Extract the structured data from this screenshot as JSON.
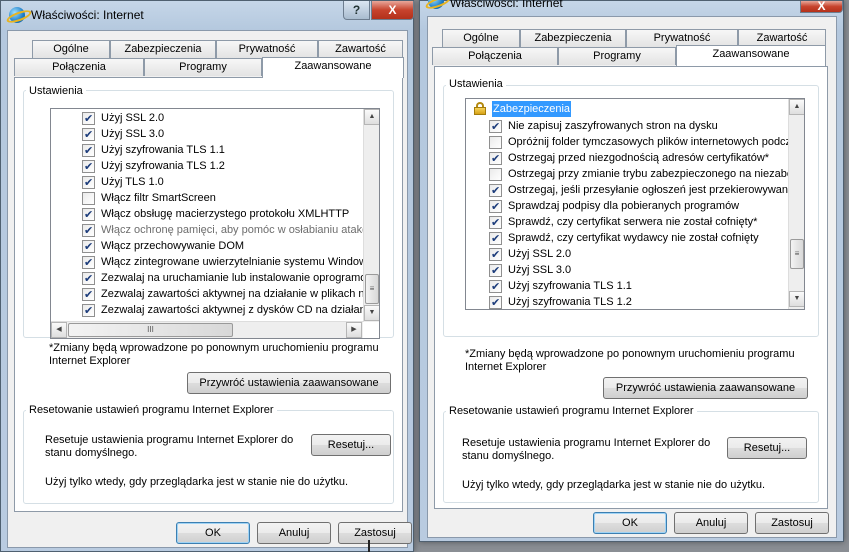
{
  "left": {
    "title": "Właściwości: Internet",
    "tabs_row1": [
      "Ogólne",
      "Zabezpieczenia",
      "Prywatność",
      "Zawartość"
    ],
    "tabs_row2": [
      "Połączenia",
      "Programy",
      "Zaawansowane"
    ],
    "settings_label": "Ustawienia",
    "items": [
      {
        "label": "Użyj SSL 2.0",
        "checked": true
      },
      {
        "label": "Użyj SSL 3.0",
        "checked": true
      },
      {
        "label": "Użyj szyfrowania TLS 1.1",
        "checked": true
      },
      {
        "label": "Użyj szyfrowania TLS 1.2",
        "checked": true
      },
      {
        "label": "Użyj TLS 1.0",
        "checked": true
      },
      {
        "label": "Włącz filtr SmartScreen",
        "checked": false
      },
      {
        "label": "Włącz obsługę macierzystego protokołu XMLHTTP",
        "checked": true
      },
      {
        "label": "Włącz ochronę pamięci, aby pomóc w osłabianiu ataków w",
        "checked": true,
        "disabled": true
      },
      {
        "label": "Włącz przechowywanie DOM",
        "checked": true
      },
      {
        "label": "Włącz zintegrowane uwierzytelnianie systemu Windows*",
        "checked": true
      },
      {
        "label": "Zezwalaj na uruchamianie lub instalowanie oprogramowan",
        "checked": true
      },
      {
        "label": "Zezwalaj zawartości aktywnej na działanie w plikach na mo",
        "checked": true
      },
      {
        "label": "Zezwalaj zawartości aktywnej z dysków CD na działanie n",
        "checked": true
      }
    ],
    "note": "*Zmiany będą wprowadzone po ponownym uruchomieniu programu Internet Explorer",
    "restore_button": "Przywróć ustawienia zaawansowane",
    "reset_group": "Resetowanie ustawień programu Internet Explorer",
    "reset_text": "Resetuje ustawienia programu Internet Explorer do stanu domyślnego.",
    "reset_button": "Resetuj...",
    "use_text": "Użyj tylko wtedy, gdy przeglądarka jest w stanie nie do użytku.",
    "ok": "OK",
    "cancel": "Anuluj",
    "apply": "Zastosuj",
    "help": "?",
    "close": "X"
  },
  "right": {
    "title": "Właściwości: Internet",
    "tabs_row1": [
      "Ogólne",
      "Zabezpieczenia",
      "Prywatność",
      "Zawartość"
    ],
    "tabs_row2": [
      "Połączenia",
      "Programy",
      "Zaawansowane"
    ],
    "settings_label": "Ustawienia",
    "category": "Zabezpieczenia",
    "items": [
      {
        "label": "Nie zapisuj zaszyfrowanych stron na dysku",
        "checked": true
      },
      {
        "label": "Opróżnij folder tymczasowych plików internetowych podcz",
        "checked": false
      },
      {
        "label": "Ostrzegaj przed niezgodnością adresów certyfikatów*",
        "checked": true
      },
      {
        "label": "Ostrzegaj przy zmianie trybu zabezpieczonego na niezabe",
        "checked": false
      },
      {
        "label": "Ostrzegaj, jeśli przesyłanie ogłoszeń jest przekierowywan",
        "checked": true
      },
      {
        "label": "Sprawdzaj podpisy dla pobieranych programów",
        "checked": true
      },
      {
        "label": "Sprawdź, czy certyfikat serwera nie został cofnięty*",
        "checked": true
      },
      {
        "label": "Sprawdź, czy certyfikat wydawcy nie został cofnięty",
        "checked": true
      },
      {
        "label": "Użyj SSL 2.0",
        "checked": true
      },
      {
        "label": "Użyj SSL 3.0",
        "checked": true
      },
      {
        "label": "Użyj szyfrowania TLS 1.1",
        "checked": true
      },
      {
        "label": "Użyj szyfrowania TLS 1.2",
        "checked": true
      }
    ],
    "note": "*Zmiany będą wprowadzone po ponownym uruchomieniu programu Internet Explorer",
    "restore_button": "Przywróć ustawienia zaawansowane",
    "reset_group": "Resetowanie ustawień programu Internet Explorer",
    "reset_text": "Resetuje ustawienia programu Internet Explorer do stanu domyślnego.",
    "reset_button": "Resetuj...",
    "use_text": "Użyj tylko wtedy, gdy przeglądarka jest w stanie nie do użytku.",
    "ok": "OK",
    "cancel": "Anuluj",
    "apply": "Zastosuj",
    "close": "X"
  },
  "scroll_glyphs": {
    "up": "▲",
    "down": "▼",
    "left": "◀",
    "right": "▶",
    "grip": "III"
  }
}
